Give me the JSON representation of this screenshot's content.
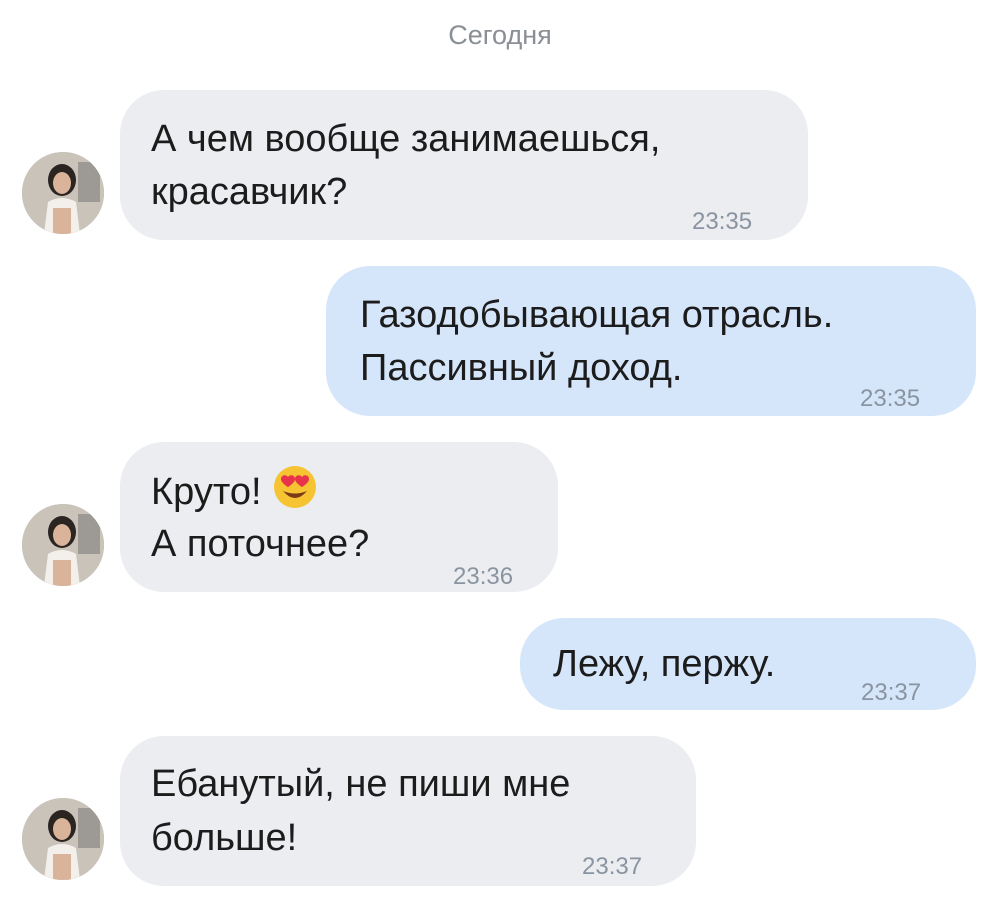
{
  "chat": {
    "date_separator": "Сегодня",
    "messages": [
      {
        "direction": "incoming",
        "lines": [
          "А чем вообще занимаешься,",
          "красавчик?"
        ],
        "time": "23:35"
      },
      {
        "direction": "outgoing",
        "lines": [
          "Газодобывающая отрасль.",
          "Пассивный доход."
        ],
        "time": "23:35"
      },
      {
        "direction": "incoming",
        "lines": [
          "Круто!",
          "А поточнее?"
        ],
        "emoji": "heart-eyes-emoji",
        "time": "23:36"
      },
      {
        "direction": "outgoing",
        "lines": [
          "Лежу, пержу."
        ],
        "time": "23:37"
      },
      {
        "direction": "incoming",
        "lines": [
          "Ебанутый, не пиши мне",
          "больше!"
        ],
        "time": "23:37"
      }
    ]
  },
  "colors": {
    "incoming_bubble": "#ebedf0",
    "outgoing_bubble": "#d5e6fb",
    "timestamp": "#8a94a1",
    "date_separator": "#8a8f96"
  }
}
